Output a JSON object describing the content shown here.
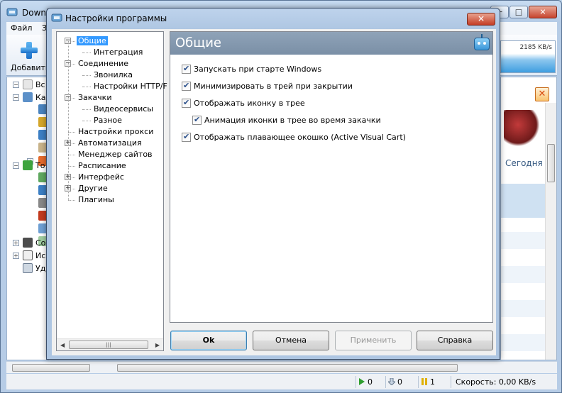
{
  "main_window": {
    "title": "Downl",
    "menu": [
      "Файл",
      "З"
    ],
    "toolbar": {
      "add_label": "Добавить"
    },
    "speed_graph_label": "2185 KB/s",
    "left_tree": [
      "Вс",
      "Ка",
      "То",
      "Co",
      "Ис",
      "Уд"
    ],
    "right": {
      "today_label": "Сегодня"
    },
    "status": {
      "active": "0",
      "waiting": "0",
      "paused": "1",
      "speed": "Скорость: 0,00 KB/s"
    }
  },
  "dialog": {
    "title": "Настройки программы",
    "tree": [
      {
        "label": "Общие",
        "level": 0,
        "expander": "minus",
        "selected": true
      },
      {
        "label": "Интеграция",
        "level": 1
      },
      {
        "label": "Соединение",
        "level": 0,
        "expander": "minus"
      },
      {
        "label": "Звонилка",
        "level": 1
      },
      {
        "label": "Настройки HTTP/F",
        "level": 1
      },
      {
        "label": "Закачки",
        "level": 0,
        "expander": "minus"
      },
      {
        "label": "Видеосервисы",
        "level": 1
      },
      {
        "label": "Разное",
        "level": 1
      },
      {
        "label": "Настройки прокси",
        "level": 0
      },
      {
        "label": "Автоматизация",
        "level": 0,
        "expander": "plus"
      },
      {
        "label": "Менеджер сайтов",
        "level": 0
      },
      {
        "label": "Расписание",
        "level": 0
      },
      {
        "label": "Интерфейс",
        "level": 0,
        "expander": "plus"
      },
      {
        "label": "Другие",
        "level": 0,
        "expander": "plus"
      },
      {
        "label": "Плагины",
        "level": 0
      }
    ],
    "panel_title": "Общие",
    "options": [
      {
        "label": "Запускать при старте Windows",
        "checked": true,
        "indent": false
      },
      {
        "label": "Минимизировать в трей при закрытии",
        "checked": true,
        "indent": false
      },
      {
        "label": "Отображать иконку в трее",
        "checked": true,
        "indent": false
      },
      {
        "label": "Анимация иконки в трее во время закачки",
        "checked": true,
        "indent": true
      },
      {
        "label": "Отображать плавающее окошко (Active Visual Cart)",
        "checked": true,
        "indent": false
      }
    ],
    "buttons": {
      "ok": "Ok",
      "cancel": "Отмена",
      "apply": "Применить",
      "help": "Справка"
    }
  }
}
